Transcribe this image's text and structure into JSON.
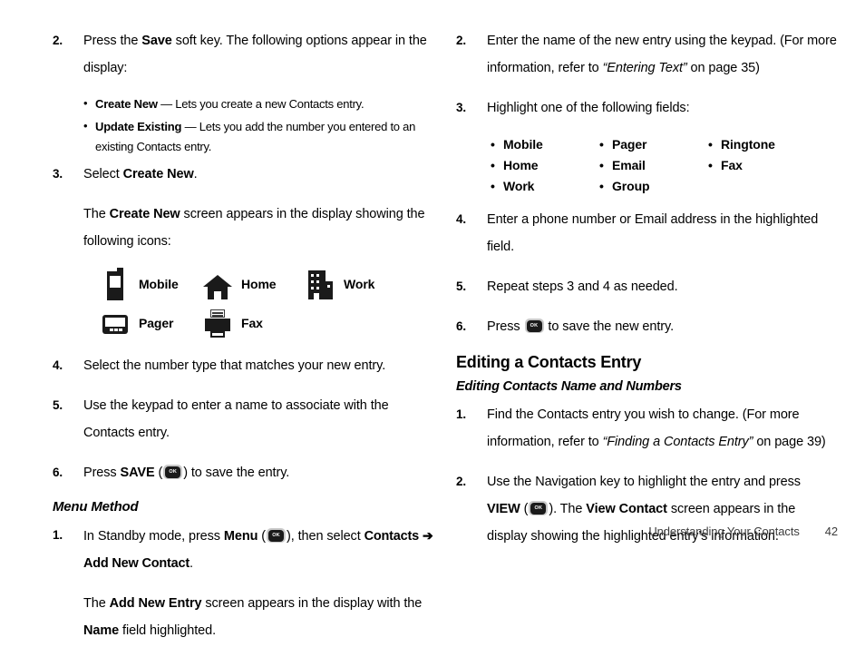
{
  "document": {
    "footer": {
      "section_title": "Understanding Your Contacts",
      "page_number": "42"
    }
  },
  "left_column": {
    "step2": {
      "number": "2.",
      "text_a": "Press the ",
      "bold_a": "Save",
      "text_b": " soft key. The following options appear in the display:"
    },
    "options": [
      {
        "term": "Create New",
        "dash": " — ",
        "desc": "Lets you create a new Contacts entry."
      },
      {
        "term": "Update Existing",
        "dash": " — ",
        "desc": "Lets you add the number you entered to an existing Contacts entry."
      }
    ],
    "step3": {
      "number": "3.",
      "text_a": "Select ",
      "bold_a": "Create New",
      "text_b": "."
    },
    "step3_cont": {
      "text_a": "The ",
      "bold_a": "Create New",
      "text_b": " screen appears in the display showing the following icons:"
    },
    "icons": [
      {
        "icon": "mobile-phone-icon",
        "label": "Mobile"
      },
      {
        "icon": "house-icon",
        "label": "Home"
      },
      {
        "icon": "office-building-icon",
        "label": "Work"
      },
      {
        "icon": "pager-icon",
        "label": "Pager"
      },
      {
        "icon": "fax-machine-icon",
        "label": "Fax"
      }
    ],
    "step4": {
      "number": "4.",
      "text_a": "Select the number type that matches your new entry."
    },
    "step5": {
      "number": "5.",
      "text_a": "Use the keypad to enter a name to associate with the Contacts entry."
    },
    "step6": {
      "number": "6.",
      "text_a": "Press ",
      "bold_a": "SAVE",
      "text_b": " (",
      "key_label": "OK",
      "text_c": ") to save the entry."
    },
    "menu_method_heading": "Menu Method",
    "m_step1": {
      "number": "1.",
      "text_a": "In Standby mode, press ",
      "bold_a": "Menu",
      "text_b": " (",
      "key_label": "OK",
      "text_c": "), then select ",
      "bold_b": "Contacts",
      "arrow": "➔",
      "bold_c": "Add New Contact",
      "text_d": "."
    },
    "m_step1_cont": {
      "text_a": "The ",
      "bold_a": "Add New Entry",
      "text_b": " screen appears in the display with the ",
      "bold_b": "Name",
      "text_c": " field highlighted."
    }
  },
  "right_column": {
    "step2": {
      "number": "2.",
      "text_a": "Enter the name of the new entry using the keypad. (For more information, refer to ",
      "italic_a": "“Entering Text”",
      "text_b": " on page 35)"
    },
    "step3": {
      "number": "3.",
      "text_a": "Highlight one of the following fields:"
    },
    "fields": [
      [
        "Mobile",
        "Home",
        "Work"
      ],
      [
        "Pager",
        "Email",
        "Group"
      ],
      [
        "Ringtone",
        "Fax"
      ]
    ],
    "step4": {
      "number": "4.",
      "text_a": "Enter a phone number or Email address in the highlighted field."
    },
    "step5": {
      "number": "5.",
      "text_a": "Repeat steps 3 and 4 as needed."
    },
    "step6": {
      "number": "6.",
      "text_a": "Press ",
      "key_label": "OK",
      "text_b": " to save the new entry."
    },
    "section_heading": "Editing a Contacts Entry",
    "sub_heading": "Editing Contacts Name and Numbers",
    "e_step1": {
      "number": "1.",
      "text_a": "Find the Contacts entry you wish to change. (For more information, refer to ",
      "italic_a": "“Finding a Contacts Entry”",
      "text_b": " on page 39)"
    },
    "e_step2": {
      "number": "2.",
      "text_a": "Use the Navigation key to highlight the entry and press ",
      "bold_a": "VIEW",
      "text_b": " (",
      "key_label": "OK",
      "text_c": "). The ",
      "bold_b": "View Contact",
      "text_d": " screen appears in the display showing the highlighted entry’s information."
    }
  }
}
